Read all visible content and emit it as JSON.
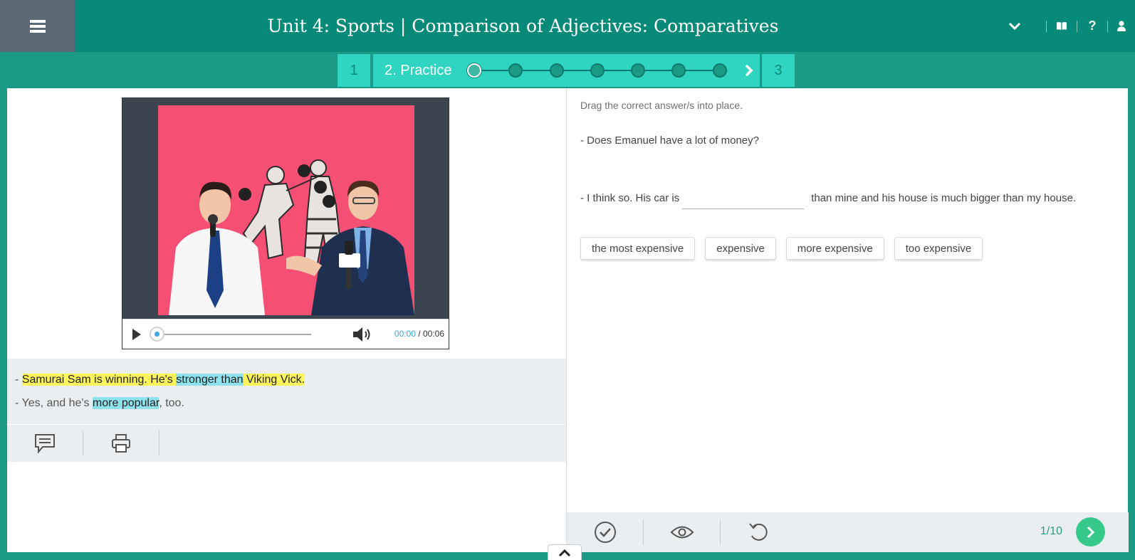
{
  "header": {
    "title": "Unit 4: Sports | Comparison of Adjectives: Comparatives",
    "icons": [
      "menu-icon",
      "chevron-down-icon",
      "book-icon",
      "help-icon",
      "user-icon"
    ],
    "help_glyph": "?"
  },
  "steps": {
    "prev_label": "1",
    "active_label": "2. Practice",
    "next_label": "3",
    "dot_count": 7,
    "current_dot": 1
  },
  "video": {
    "time_current": "00:00",
    "time_separator": " / ",
    "time_total": "00:06",
    "progress": 0
  },
  "transcript": {
    "line1": {
      "dash": "- ",
      "part1": "Samurai Sam is winning. He's ",
      "highlight": "stronger than",
      "part2": " Viking Vick."
    },
    "line2": {
      "dash": "- ",
      "part1": "Yes, and he's ",
      "highlight": "more popular",
      "part2": ", too."
    }
  },
  "exercise": {
    "instruction": "Drag the correct answer/s into place.",
    "question": "- Does Emanuel have a lot of money?",
    "answer_before": "- I think so. His car is",
    "answer_after": "than mine and his house is much bigger than my house.",
    "options": [
      "the most expensive",
      "expensive",
      "more expensive",
      "too expensive"
    ]
  },
  "footer": {
    "page": "1/10"
  },
  "colors": {
    "header": "#088a78",
    "accent": "#2fd5c0",
    "next_button": "#35c98a",
    "highlight_yellow": "#fdf55c",
    "highlight_blue": "#8ee2ee"
  }
}
